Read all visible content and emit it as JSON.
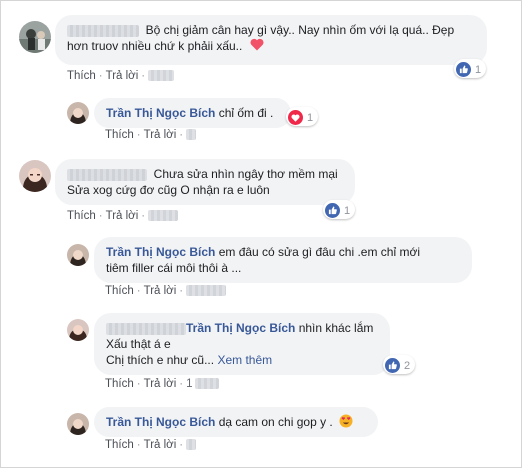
{
  "comments": [
    {
      "text": "Bộ chị giảm cân hay gì vậy.. Nay nhìn ốm với lạ quá.. Đẹp",
      "text2": "hơn truov nhiều chứ k phảii xấu..",
      "react_count": "1",
      "reaction": "like-icon",
      "like_label": "Thích",
      "reply_label": "Trả lời"
    },
    {
      "name": "Trần Thị Ngọc Bích",
      "text": "chỉ ốm đi .",
      "react_count": "1",
      "reaction": "love-icon",
      "like_label": "Thích",
      "reply_label": "Trả lời"
    },
    {
      "text": "Chưa sửa nhìn ngây thơ mềm mại",
      "text2": "Sửa xog cứg đơ cũg O nhận ra e luôn",
      "react_count": "1",
      "reaction": "like-icon",
      "like_label": "Thích",
      "reply_label": "Trả lời"
    },
    {
      "name": "Trần Thị Ngọc Bích",
      "text": "em đâu có sửa gì đâu chi .em chỉ mới",
      "text2": "tiêm filler cái môi thôi à ...",
      "like_label": "Thích",
      "reply_label": "Trả lời"
    },
    {
      "tagged_name": "Trần Thị Ngọc Bích",
      "text": "nhìn khác lắm",
      "text2": "Xấu thật á e",
      "text3": "Chị thích e như cũ...",
      "see_more": "Xem thêm",
      "react_count": "2",
      "reaction": "like-icon",
      "like_label": "Thích",
      "reply_label": "Trả lời",
      "time": "1"
    },
    {
      "name": "Trần Thị Ngọc Bích",
      "text": "dạ cam on chi gop y .",
      "like_label": "Thích",
      "reply_label": "Trả lời"
    }
  ],
  "colors": {
    "bubble": "#f2f3f5",
    "name": "#385898",
    "like": "#4267b2",
    "love": "#f0284a"
  }
}
